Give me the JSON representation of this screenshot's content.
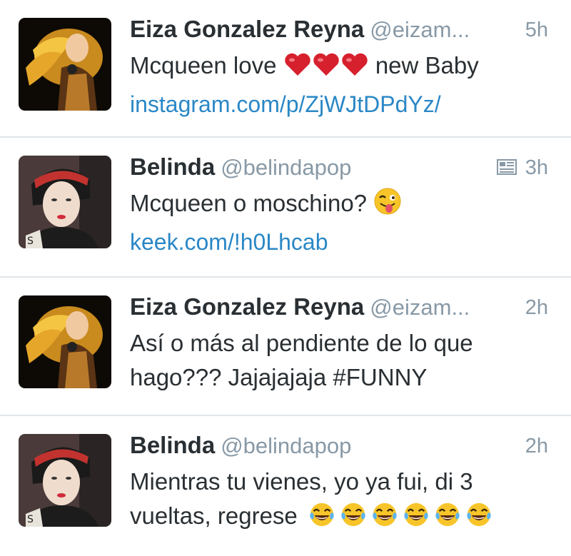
{
  "tweets": [
    {
      "name": "Eiza Gonzalez Reyna",
      "handle": "@eizam...",
      "time": "5h",
      "text_before": "Mcqueen love",
      "text_after": "new Baby",
      "link": "instagram.com/p/ZjWJtDPdYz/",
      "emoji": "heart",
      "emoji_count": 3,
      "avatar": "concert-photo-avatar"
    },
    {
      "name": "Belinda",
      "handle": "@belindapop",
      "time": "3h",
      "text_before": "Mcqueen o moschino?",
      "link": "keek.com/!h0Lhcab",
      "emoji": "winking-tongue-face",
      "emoji_count": 1,
      "has_media_icon": true,
      "avatar": "portrait-avatar"
    },
    {
      "name": "Eiza Gonzalez Reyna",
      "handle": "@eizam...",
      "time": "2h",
      "text_line1": "Así o más al pendiente de lo que",
      "text_line2": "hago??? Jajajajaja #FUNNY",
      "avatar": "concert-photo-avatar"
    },
    {
      "name": "Belinda",
      "handle": "@belindapop",
      "time": "2h",
      "text_line1": "Mientras tu vienes, yo ya fui, di 3",
      "text_line2": "vueltas, regrese",
      "emoji": "tears-of-joy-face",
      "emoji_count": 6,
      "avatar": "portrait-avatar"
    }
  ],
  "colors": {
    "name": "#292f33",
    "meta": "#8899a6",
    "link": "#2a87c6",
    "divider": "#e1e6e9"
  }
}
